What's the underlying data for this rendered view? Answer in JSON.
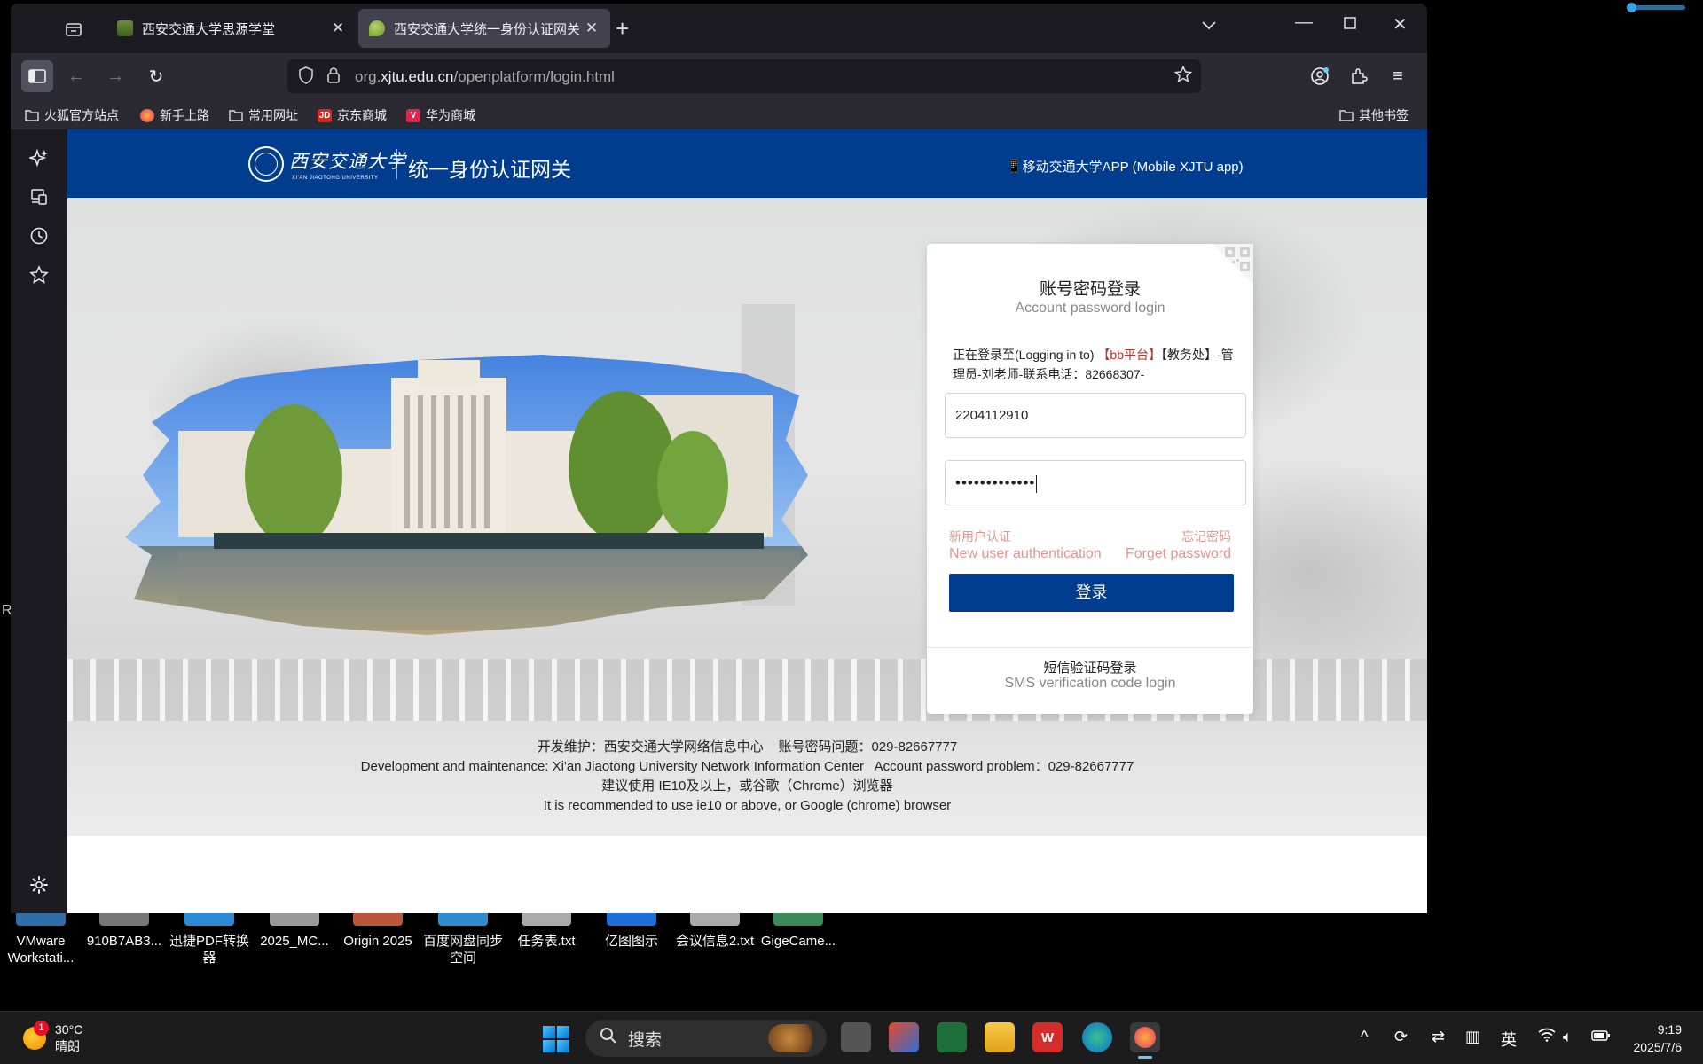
{
  "browser": {
    "tabs": [
      {
        "title": "西安交通大学思源学堂",
        "active": false
      },
      {
        "title": "西安交通大学统一身份认证网关",
        "active": true
      }
    ],
    "url_prefix": "org.",
    "url_domain": "xjtu.edu.cn",
    "url_path": "/openplatform/login.html",
    "bookmarks": [
      {
        "label": "火狐官方站点",
        "icon": "folder-icon"
      },
      {
        "label": "新手上路",
        "icon": "firefox-icon"
      },
      {
        "label": "常用网址",
        "icon": "folder-icon"
      },
      {
        "label": "京东商城",
        "icon": "jd-icon"
      },
      {
        "label": "华为商城",
        "icon": "vmall-icon"
      }
    ],
    "other_bookmarks": "其他书签"
  },
  "page": {
    "header": {
      "logo_script": "西安交通大学",
      "logo_english": "XI'AN JIAOTONG UNIVERSITY",
      "title": "统一身份认证网关",
      "app_link": "📱移动交通大学APP (Mobile XJTU app)"
    },
    "login": {
      "title": "账号密码登录",
      "subtitle": "Account password login",
      "logging_in_prefix": "正在登录至(Logging in to)",
      "logging_in_target": "【bb平台】",
      "logging_in_suffix": "【教务处】-管理员-刘老师-联系电话：82668307-",
      "username_value": "2204112910",
      "password_mask": "•••••••••••••",
      "new_user_cn": "新用户认证",
      "new_user_en": "New user authentication",
      "forget_cn": "忘记密码",
      "forget_en": "Forget password",
      "login_button": "登录",
      "sms_cn": "短信验证码登录",
      "sms_en": "SMS verification code login"
    },
    "footer": {
      "line1": "开发维护：西安交通大学网络信息中心    账号密码问题：029-82667777",
      "line2": "Development and maintenance: Xi'an Jiaotong University Network Information Center   Account password problem：029-82667777",
      "line3": "建议使用 IE10及以上，或谷歌（Chrome）浏览器",
      "line4": "It is recommended to use ie10 or above, or Google (chrome) browser"
    }
  },
  "desktop": {
    "icons": [
      {
        "label": "VMware Workstati..."
      },
      {
        "label": "910B7AB3..."
      },
      {
        "label": "迅捷PDF转换器"
      },
      {
        "label": "2025_MC..."
      },
      {
        "label": "Origin 2025"
      },
      {
        "label": "百度网盘同步空间"
      },
      {
        "label": "任务表.txt"
      },
      {
        "label": "亿图图示"
      },
      {
        "label": "会议信息2.txt"
      },
      {
        "label": "GigeCame..."
      }
    ],
    "side_letter": "R"
  },
  "taskbar": {
    "weather_temp": "30°C",
    "weather_desc": "晴朗",
    "weather_badge": "1",
    "search_label": "搜索",
    "ime": "英",
    "time": "9:19",
    "date": "2025/7/6"
  },
  "colors": {
    "brand_blue": "#003d8f",
    "link_pink": "#e7958f",
    "target_red": "#c0312a"
  }
}
